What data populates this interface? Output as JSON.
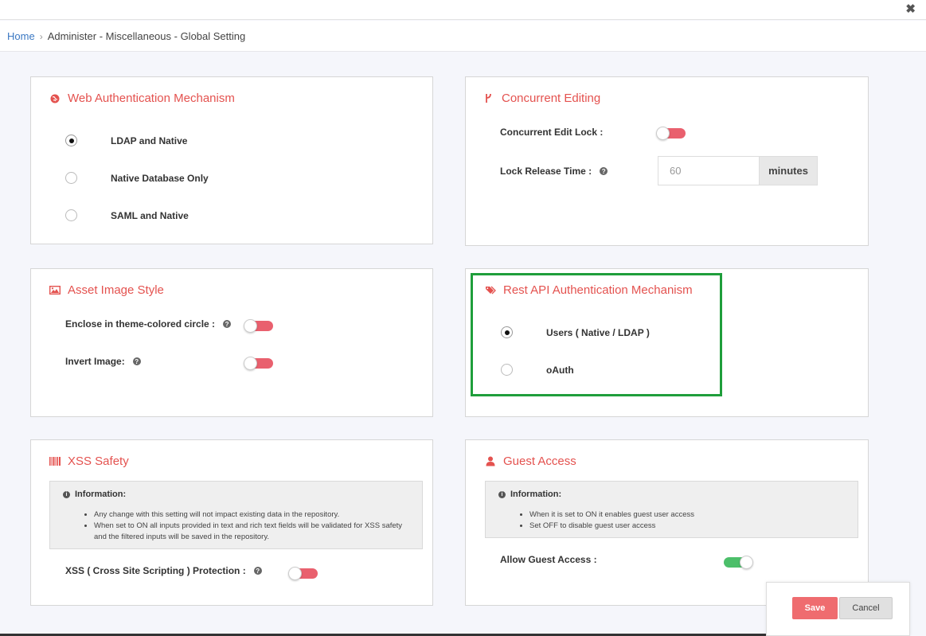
{
  "breadcrumb": {
    "home": "Home",
    "separator": "›",
    "current": "Administer - Miscellaneous - Global Setting"
  },
  "close_icon": "✖",
  "web_auth": {
    "title": "Web Authentication Mechanism",
    "icon": "globe-icon",
    "options": [
      {
        "label": "LDAP and Native",
        "selected": true
      },
      {
        "label": "Native Database Only",
        "selected": false
      },
      {
        "label": "SAML and Native",
        "selected": false
      }
    ]
  },
  "concurrent": {
    "title": "Concurrent Editing",
    "icon": "branch-icon",
    "lock_label": "Concurrent Edit Lock :",
    "lock_on": false,
    "release_label": "Lock Release Time :",
    "release_value": "60",
    "release_unit": "minutes"
  },
  "asset_image": {
    "title": "Asset Image Style",
    "icon": "image-icon",
    "enclose_label": "Enclose in theme-colored circle :",
    "enclose_on": false,
    "invert_label": "Invert Image:",
    "invert_on": false
  },
  "rest_api": {
    "title": "Rest API Authentication Mechanism",
    "icon": "tags-icon",
    "options": [
      {
        "label": "Users ( Native / LDAP )",
        "selected": true
      },
      {
        "label": "oAuth",
        "selected": false
      }
    ]
  },
  "xss": {
    "title": "XSS Safety",
    "icon": "barcode-icon",
    "info_title": "Information:",
    "info_items": [
      "Any change with this setting will not impact existing data in the repository.",
      "When set to ON all inputs provided in text and rich text fields will be validated for XSS safety and the filtered inputs will be saved in the repository."
    ],
    "protection_label": "XSS ( Cross Site Scripting ) Protection :",
    "protection_on": false
  },
  "guest": {
    "title": "Guest Access",
    "icon": "user-icon",
    "info_title": "Information:",
    "info_items": [
      "When it is set to ON it enables guest user access",
      "Set OFF to disable guest user access"
    ],
    "allow_label": "Allow Guest Access :",
    "allow_on": true
  },
  "footer": {
    "save": "Save",
    "cancel": "Cancel"
  },
  "colors": {
    "accent": "#e4524f",
    "toggle_off": "#e9606e",
    "toggle_on": "#4cbf6a",
    "highlight": "#1f9e3b",
    "link": "#3b78c3"
  }
}
